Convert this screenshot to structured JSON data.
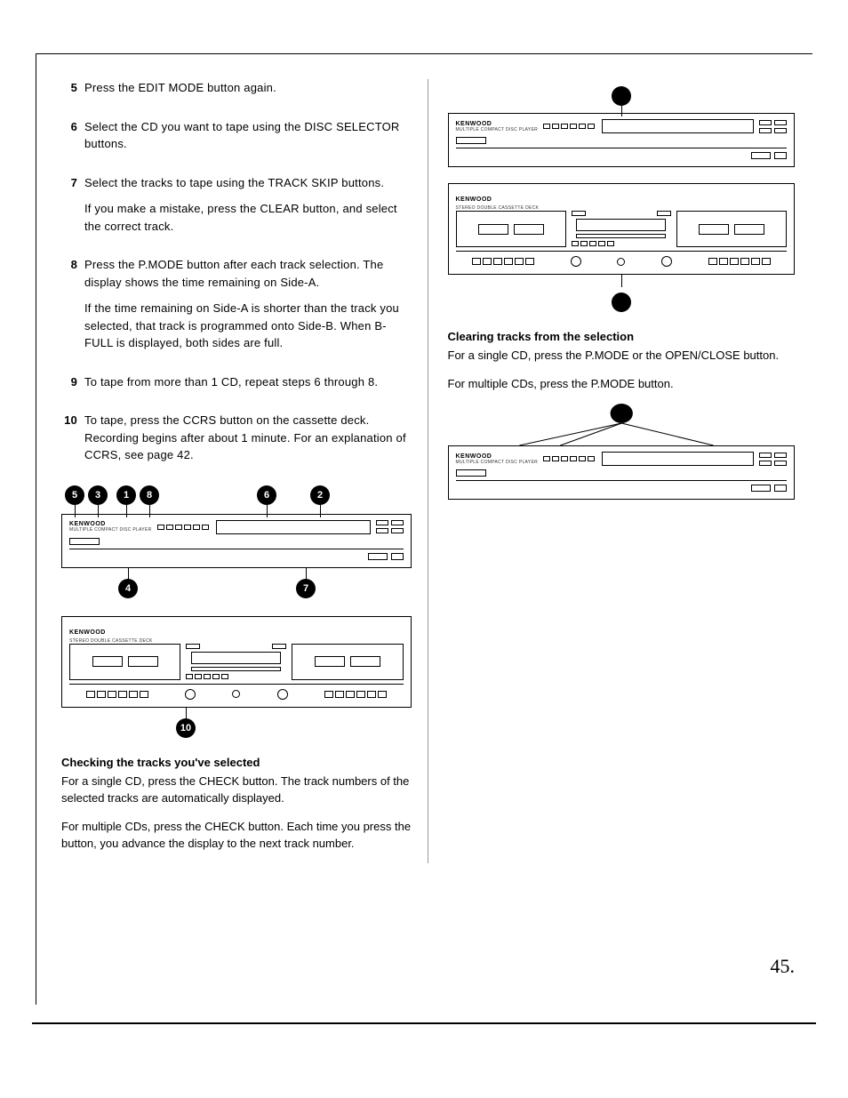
{
  "steps": [
    {
      "num": "5",
      "paras": [
        "Press the EDIT MODE button again."
      ]
    },
    {
      "num": "6",
      "paras": [
        "Select the CD you want to tape using the DISC SELECTOR buttons."
      ]
    },
    {
      "num": "7",
      "paras": [
        "Select the tracks to tape using the TRACK SKIP buttons.",
        "If you make a mistake, press the CLEAR button, and select the correct track."
      ]
    },
    {
      "num": "8",
      "paras": [
        "Press the P.MODE button after each track selection. The display shows the time remaining on Side-A.",
        "If the time remaining on Side-A is shorter than the track you selected, that track is programmed onto Side-B. When B-FULL is displayed, both sides are full."
      ]
    },
    {
      "num": "9",
      "paras": [
        "To tape from more than 1 CD, repeat steps 6 through 8."
      ]
    },
    {
      "num": "10",
      "paras": [
        "To tape, press the CCRS button on the cassette deck. Recording begins after about 1 minute. For an explanation of CCRS, see page 42."
      ]
    }
  ],
  "left_diagram": {
    "top_callouts": [
      "5",
      "3",
      "1",
      "8",
      "6",
      "2"
    ],
    "bottom_callouts": [
      "4",
      "7"
    ],
    "tape_callout": "10",
    "brand": "KENWOOD",
    "sublabel": "MULTIPLE COMPACT DISC PLAYER",
    "tape_brand": "KENWOOD",
    "tape_sublabel": "STEREO DOUBLE CASSETTE DECK"
  },
  "checking": {
    "heading": "Checking the tracks you've selected",
    "p1": "For a single CD, press the CHECK button. The track numbers of the selected tracks are automatically displayed.",
    "p2": "For multiple CDs, press the CHECK button. Each time you press the button, you advance the display to the next track number."
  },
  "clearing": {
    "heading": "Clearing tracks from the selection",
    "p1": "For a single CD, press the P.MODE or the OPEN/CLOSE button.",
    "p2": "For multiple CDs, press the P.MODE button."
  },
  "right_diagrams": {
    "cd_brand": "KENWOOD",
    "cd_sublabel": "MULTIPLE COMPACT DISC PLAYER",
    "tape_brand": "KENWOOD",
    "tape_sublabel": "STEREO DOUBLE CASSETTE DECK"
  },
  "page_number": "45."
}
